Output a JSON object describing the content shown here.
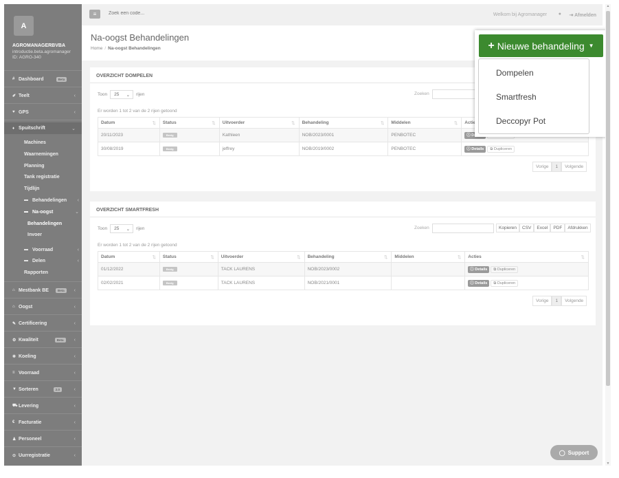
{
  "company": {
    "logo_letter": "A",
    "name": "AGROMANAGERBVBA",
    "email": "introductie.beta.agromanager",
    "id": "ID: AGRO-340"
  },
  "topbar": {
    "search_placeholder": "Zoek een code...",
    "welcome": "Welkom bij Agromanager",
    "logout": "Afmelden"
  },
  "sidebar": {
    "items": [
      {
        "label": "Dashboard",
        "icon": "#",
        "badge": "Beta"
      },
      {
        "label": "Teelt",
        "icon": "✐"
      },
      {
        "label": "GPS",
        "icon": "♥"
      },
      {
        "label": "Spuitschrift",
        "icon": "♦"
      },
      {
        "label": "Mestbank BE",
        "icon": "⌂",
        "badge": "Beta"
      },
      {
        "label": "Oogst",
        "icon": "⌂"
      },
      {
        "label": "Certificering",
        "icon": "✎"
      },
      {
        "label": "Kwaliteit",
        "icon": "⚙",
        "badge": "Beta"
      },
      {
        "label": "Koeling",
        "icon": "❄"
      },
      {
        "label": "Voorraad",
        "icon": "≡"
      },
      {
        "label": "Sorteren",
        "icon": "▼",
        "badge": "2.0"
      },
      {
        "label": "Levering",
        "icon": "⛟"
      },
      {
        "label": "Facturatie",
        "icon": "€"
      },
      {
        "label": "Personeel",
        "icon": "♟"
      },
      {
        "label": "Uurregistratie",
        "icon": "⊙"
      }
    ],
    "spuit_sub": [
      "Machines",
      "Waarnemingen",
      "Planning",
      "Tank registratie",
      "Tijdlijn"
    ],
    "behandelingen": "Behandelingen",
    "na_oogst": "Na-oogst",
    "na_oogst_sub": [
      "Behandelingen",
      "Invoer"
    ],
    "voorraad": "Voorraad",
    "delen": "Delen",
    "rapporten": "Rapporten"
  },
  "page": {
    "title": "Na-oogst Behandelingen",
    "crumb_home": "Home",
    "crumb_current": "Na-oogst Behandelingen"
  },
  "common": {
    "toon": "Toon",
    "per_page": "25",
    "rijen": "rijen",
    "zoeken": "Zoeken",
    "export": [
      "Kopieren",
      "CSV",
      "Excel",
      "PDF",
      "Afdrukken"
    ],
    "prev": "Vorige",
    "page": "1",
    "next": "Volgende",
    "details": "Details",
    "dupliceren": "Dupliceren"
  },
  "dompelen": {
    "title": "OVERZICHT DOMPELEN",
    "info": "Er worden 1 tot 2 van de 2 rijen getoond",
    "headers": [
      "Datum",
      "Status",
      "Uitvoerder",
      "Behandeling",
      "Middelen",
      "Acties"
    ],
    "rows": [
      {
        "datum": "20/11/2023",
        "status": "Bezig",
        "uitvoerder": "Kathleen",
        "behandeling": "NOB/2023/0001",
        "middelen": "PENBOTEC"
      },
      {
        "datum": "30/08/2019",
        "status": "Bezig",
        "uitvoerder": "jeffrey",
        "behandeling": "NOB/2019/0002",
        "middelen": "PENBOTEC"
      }
    ]
  },
  "smartfresh": {
    "title": "OVERZICHT SMARTFRESH",
    "info": "Er worden 1 tot 2 van de 2 rijen getoond",
    "headers": [
      "Datum",
      "Status",
      "Uitvoerder",
      "Behandeling",
      "Middelen",
      "Acties"
    ],
    "rows": [
      {
        "datum": "01/12/2022",
        "status": "Bezig",
        "uitvoerder": "TACK LAURENS",
        "behandeling": "NOB/2023/0002",
        "middelen": ""
      },
      {
        "datum": "02/02/2021",
        "status": "Bezig",
        "uitvoerder": "TACK LAURENS",
        "behandeling": "NOB/2021/0001",
        "middelen": ""
      }
    ]
  },
  "dropdown": {
    "button": "Nieuwe behandeling",
    "items": [
      "Dompelen",
      "Smartfresh",
      "Deccopyr Pot"
    ]
  },
  "support": "Support",
  "colors": {
    "primary_green": "#3c8a2f",
    "sidebar": "#7d7d7d"
  }
}
